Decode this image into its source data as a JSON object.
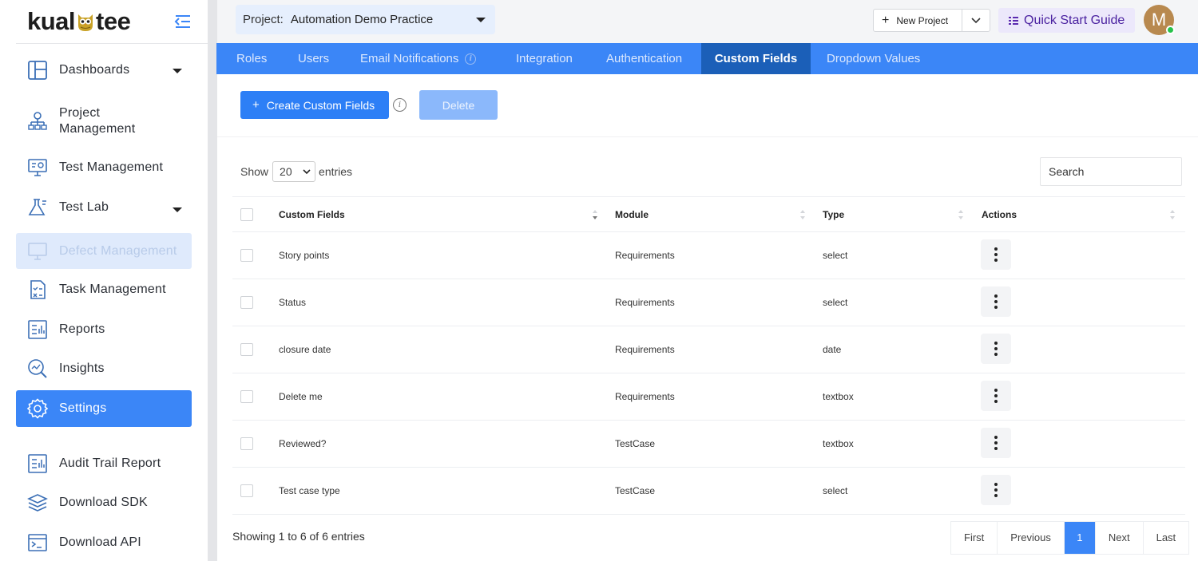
{
  "brand": {
    "logo_left": "kual",
    "logo_right": "tee"
  },
  "sidebar": {
    "items": [
      {
        "label": "Dashboards",
        "icon": "dashboard-icon",
        "caret": true,
        "state": "normal"
      },
      {
        "label": "Project Management",
        "icon": "sitemap-icon",
        "caret": false,
        "state": "normal"
      },
      {
        "label": "Test Management",
        "icon": "monitor-settings-icon",
        "caret": false,
        "state": "normal"
      },
      {
        "label": "Test Lab",
        "icon": "flask-icon",
        "caret": true,
        "state": "normal"
      },
      {
        "label": "Defect Management",
        "icon": "defect-icon",
        "caret": false,
        "state": "disabled"
      },
      {
        "label": "Task Management",
        "icon": "task-checklist-icon",
        "caret": false,
        "state": "normal"
      },
      {
        "label": "Reports",
        "icon": "report-icon",
        "caret": false,
        "state": "normal"
      },
      {
        "label": "Insights",
        "icon": "insights-icon",
        "caret": false,
        "state": "normal"
      },
      {
        "label": "Settings",
        "icon": "gear-icon",
        "caret": false,
        "state": "active"
      },
      {
        "label": "Audit Trail Report",
        "icon": "audit-report-icon",
        "caret": false,
        "state": "normal"
      },
      {
        "label": "Download SDK",
        "icon": "layers-icon",
        "caret": false,
        "state": "normal"
      },
      {
        "label": "Download API",
        "icon": "terminal-icon",
        "caret": false,
        "state": "normal"
      }
    ]
  },
  "header": {
    "project_label": "Project:",
    "project_value": "Automation Demo Practice",
    "new_project": "New Project",
    "quick_start": "Quick Start Guide",
    "avatar_initial": "M"
  },
  "tabs": [
    {
      "label": "Roles",
      "active": false
    },
    {
      "label": "Users",
      "active": false
    },
    {
      "label": "Email Notifications",
      "active": false,
      "info": true
    },
    {
      "label": "Integration",
      "active": false
    },
    {
      "label": "Authentication",
      "active": false
    },
    {
      "label": "Custom Fields",
      "active": true
    },
    {
      "label": "Dropdown Values",
      "active": false
    }
  ],
  "toolbar": {
    "create_label": "Create Custom Fields",
    "delete_label": "Delete"
  },
  "table_controls": {
    "show_label": "Show",
    "page_length": "20",
    "entries_label": "entries",
    "search_placeholder": "Search"
  },
  "table": {
    "columns": [
      "Custom Fields",
      "Module",
      "Type",
      "Actions"
    ],
    "rows": [
      {
        "field": "Story points",
        "module": "Requirements",
        "type": "select"
      },
      {
        "field": "Status",
        "module": "Requirements",
        "type": "select"
      },
      {
        "field": "closure date",
        "module": "Requirements",
        "type": "date"
      },
      {
        "field": "Delete me",
        "module": "Requirements",
        "type": "textbox"
      },
      {
        "field": "Reviewed?",
        "module": "TestCase",
        "type": "textbox"
      },
      {
        "field": "Test case type",
        "module": "TestCase",
        "type": "select"
      }
    ]
  },
  "footer": {
    "info": "Showing 1 to 6 of 6 entries",
    "pagination": [
      "First",
      "Previous",
      "1",
      "Next",
      "Last"
    ],
    "current_page": "1"
  },
  "colors": {
    "primary": "#3b86f7",
    "tab_active": "#1b5fb8",
    "quick_start_bg": "#ece8fb",
    "quick_start_text": "#4a21a0"
  }
}
